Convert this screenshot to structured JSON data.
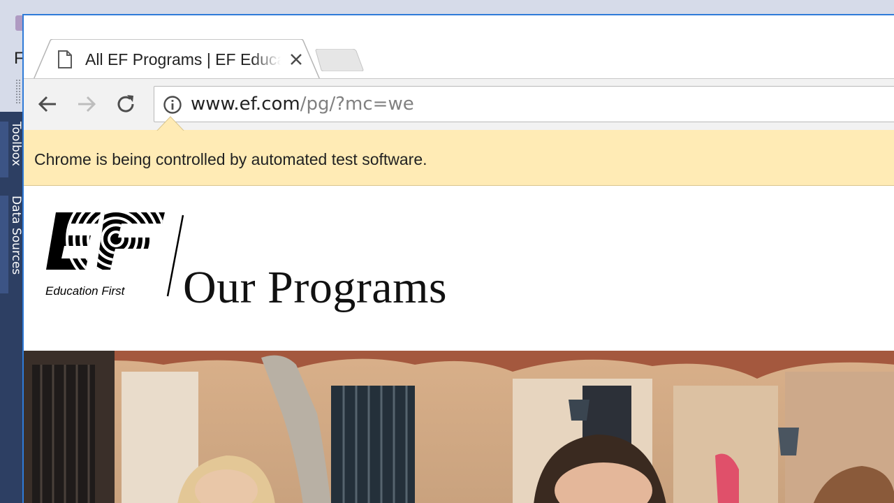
{
  "ide": {
    "menu_letter": "F",
    "side_tabs": [
      "Toolbox",
      "Data Sources"
    ]
  },
  "browser": {
    "tab": {
      "title": "All EF Programs | EF Education First"
    },
    "address": {
      "host": "www.ef.com",
      "path": "/pg/?mc=we"
    },
    "infobar": {
      "message": "Chrome is being controlled by automated test software."
    }
  },
  "page": {
    "logo": {
      "wordmark": "EF",
      "tagline": "Education First"
    },
    "title": "Our Programs"
  },
  "colors": {
    "infobar_bg": "#ffebb5",
    "window_accent": "#2f7bd8",
    "ide_side": "#2d3f63"
  }
}
